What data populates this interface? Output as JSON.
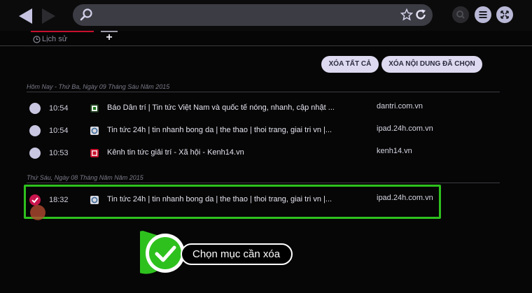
{
  "tabs": {
    "history_label": "Lịch sử",
    "add_label": "+"
  },
  "actions": {
    "clear_all": "XÓA TẤT CẢ",
    "clear_selected": "XÓA NỘI DUNG ĐÃ CHỌN"
  },
  "groups": [
    {
      "title": "Hôm Nay - Thứ Ba, Ngày 09 Tháng Sáu Năm 2015",
      "items": [
        {
          "time": "10:54",
          "title": "Báo Dân trí | Tin tức Việt Nam và quốc tế nóng, nhanh, cập nhật ...",
          "domain": "dantri.com.vn",
          "favicon": "dantri-favicon",
          "checked": false
        },
        {
          "time": "10:54",
          "title": "Tin tức 24h | tin nhanh bong da | the thao | thoi trang, giai tri vn |...",
          "domain": "ipad.24h.com.vn",
          "favicon": "24h-favicon",
          "checked": false
        },
        {
          "time": "10:53",
          "title": "Kênh tin tức giải trí - Xã hội - Kenh14.vn",
          "domain": "kenh14.vn",
          "favicon": "kenh14-favicon",
          "checked": false
        }
      ]
    },
    {
      "title": "Thứ Sáu, Ngày 08 Tháng Năm Năm 2015",
      "items": [
        {
          "time": "18:32",
          "title": "Tin tức 24h | tin nhanh bong da | the thao | thoi trang, giai tri vn |...",
          "domain": "ipad.24h.com.vn",
          "favicon": "24h-favicon",
          "checked": true
        }
      ]
    }
  ],
  "callout": {
    "text": "Chọn mục cần xóa"
  },
  "colors": {
    "highlight": "#2ec11e",
    "accent": "#c8102e",
    "checked": "#c8154e"
  }
}
